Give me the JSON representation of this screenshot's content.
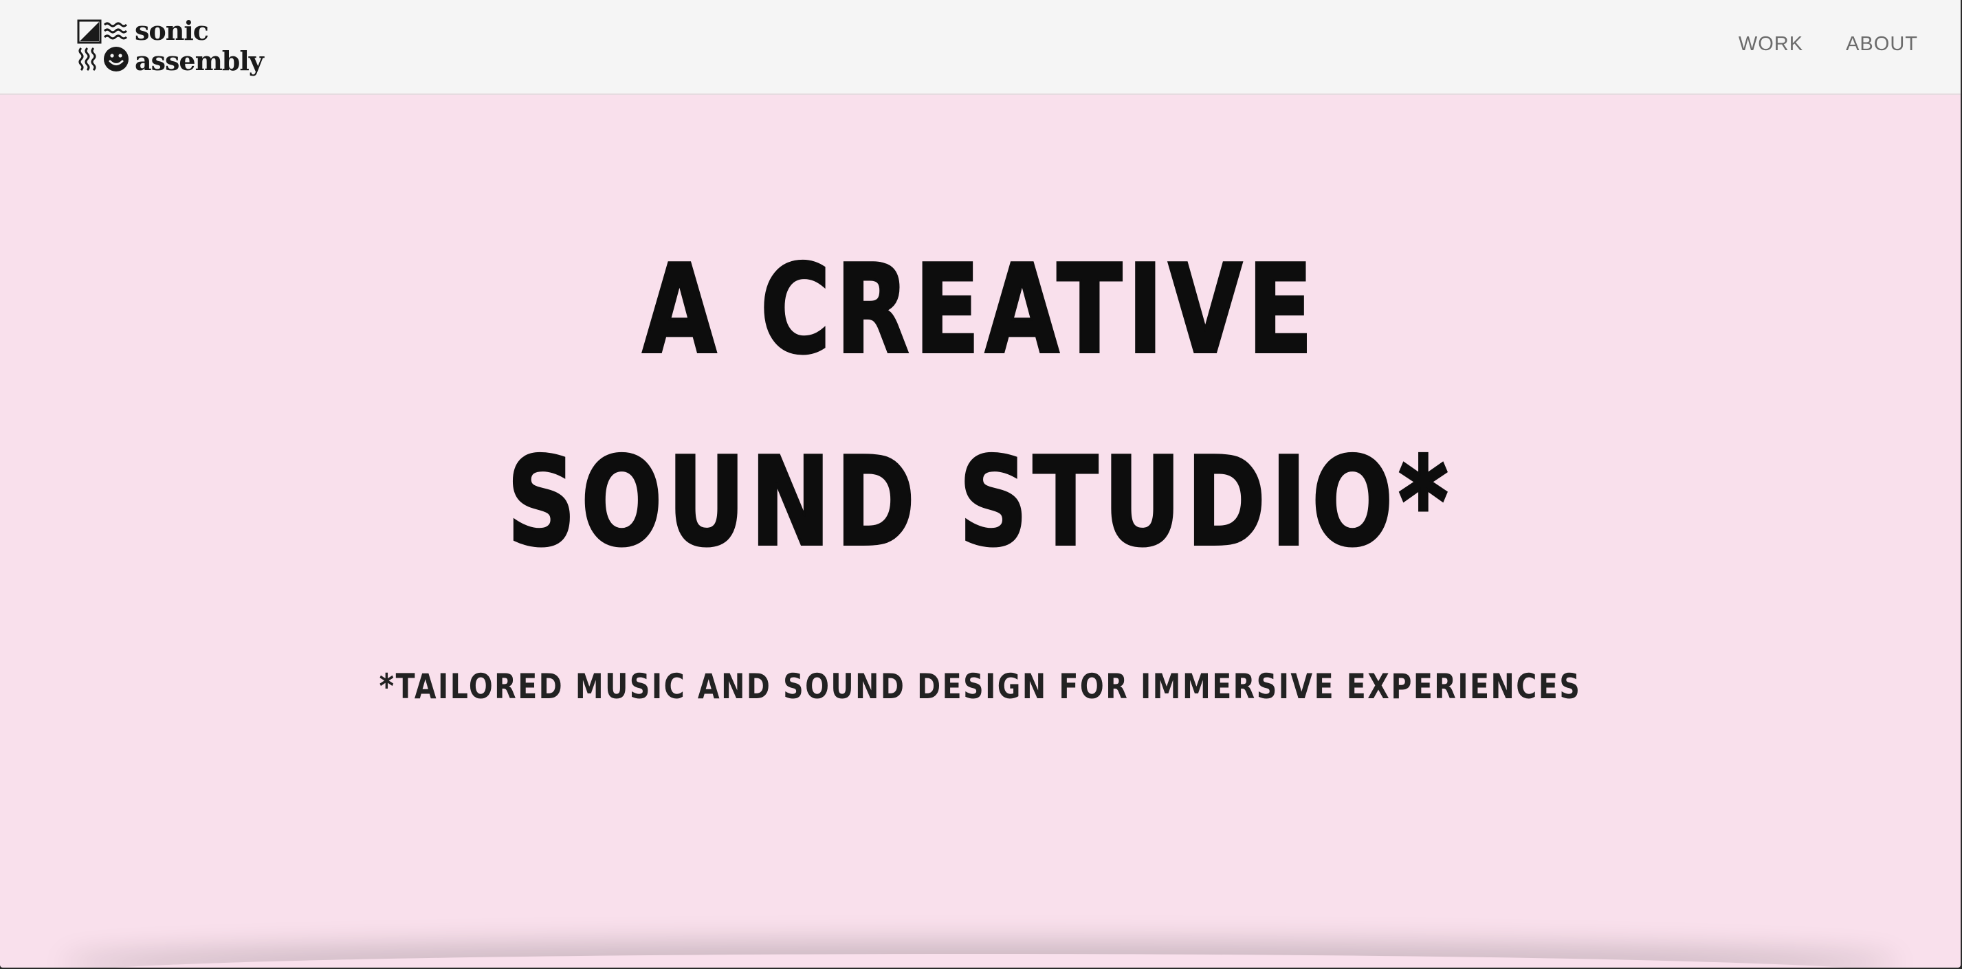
{
  "header": {
    "logo": {
      "line1": "sonic",
      "line2": "assembly"
    },
    "nav": [
      {
        "label": "WORK"
      },
      {
        "label": "ABOUT"
      }
    ]
  },
  "hero": {
    "headline_line1": "A CREATIVE",
    "headline_line2": "SOUND STUDIO*",
    "tagline": "*TAILORED MUSIC AND SOUND DESIGN FOR IMMERSIVE EXPERIENCES"
  },
  "colors": {
    "background": "#f9e0ec",
    "header_bg": "#f5f5f5",
    "text": "#0d0d0d",
    "nav_text": "#6b6b6b"
  }
}
